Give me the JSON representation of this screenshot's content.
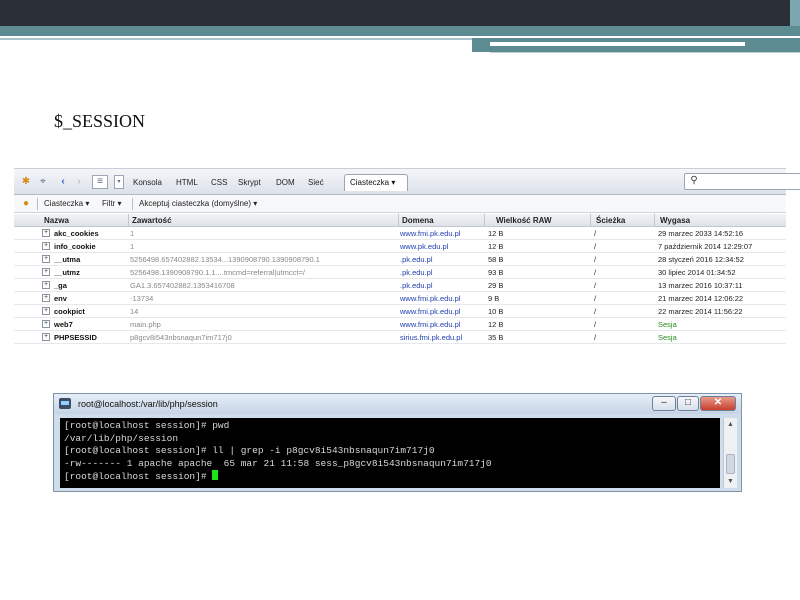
{
  "slide": {
    "title": "$_SESSION"
  },
  "firebug": {
    "tabs": [
      "Konsola",
      "HTML",
      "CSS",
      "Skrypt",
      "DOM",
      "Sieć"
    ],
    "active_tab": "Ciasteczka ▾",
    "search_placeholder": "",
    "subtoolbar": {
      "cookies_menu": "Ciasteczka ▾",
      "filter_menu": "Filtr ▾",
      "accept_menu": "Akceptuj ciasteczka (domyślne) ▾"
    },
    "columns": [
      "Nazwa",
      "Zawartość",
      "Domena",
      "Wielkość RAW",
      "Ścieżka",
      "Wygasa"
    ],
    "cookies": [
      {
        "name": "akc_cookies",
        "value": "1",
        "domain": "www.fmi.pk.edu.pl",
        "size": "12 B",
        "path": "/",
        "expires": "29 marzec 2033 14:52:16"
      },
      {
        "name": "info_cookie",
        "value": "1",
        "domain": "www.pk.edu.pl",
        "size": "12 B",
        "path": "/",
        "expires": "7 październik 2014 12:29:07"
      },
      {
        "name": "__utma",
        "value": "5256498.657402882.13534...1390908790.1390908790.1",
        "domain": ".pk.edu.pl",
        "size": "58 B",
        "path": "/",
        "expires": "28 styczeń 2016 12:34:52"
      },
      {
        "name": "__utmz",
        "value": "5256498.1390908790.1.1....tmcmd=referral|utmcct=/",
        "domain": ".pk.edu.pl",
        "size": "93 B",
        "path": "/",
        "expires": "30 lipiec 2014 01:34:52"
      },
      {
        "name": "_ga",
        "value": "GA1.3.657402882.1353416708",
        "domain": ".pk.edu.pl",
        "size": "29 B",
        "path": "/",
        "expires": "13 marzec 2016 10:37:11"
      },
      {
        "name": "env",
        "value": "-13734",
        "domain": "www.fmi.pk.edu.pl",
        "size": "9 B",
        "path": "/",
        "expires": "21 marzec 2014 12:06:22"
      },
      {
        "name": "cookpict",
        "value": "14",
        "domain": "www.fmi.pk.edu.pl",
        "size": "10 B",
        "path": "/",
        "expires": "22 marzec 2014 11:56:22"
      },
      {
        "name": "web7",
        "value": "main.php",
        "domain": "www.fmi.pk.edu.pl",
        "size": "12 B",
        "path": "/",
        "expires": "Sesja"
      },
      {
        "name": "PHPSESSID",
        "value": "p8gcv8i543nbsnaqun7im717j0",
        "domain": "sirius.fmi.pk.edu.pl",
        "size": "35 B",
        "path": "/",
        "expires": "Sesja"
      }
    ]
  },
  "terminal": {
    "title": "root@localhost:/var/lib/php/session",
    "buttons": [
      "–",
      "□",
      "✕"
    ],
    "lines": [
      "[root@localhost session]# pwd",
      "/var/lib/php/session",
      "[root@localhost session]# ll | grep -i p8gcv8i543nbsnaqun7im717j0",
      "-rw------- 1 apache apache  65 mar 21 11:58 sess_p8gcv8i543nbsnaqun7im717j0",
      "[root@localhost session]# "
    ]
  },
  "colors": {
    "session_green": "#2b8a1e",
    "domain_blue": "#1f3fb0",
    "cursor_green": "#19e619"
  }
}
